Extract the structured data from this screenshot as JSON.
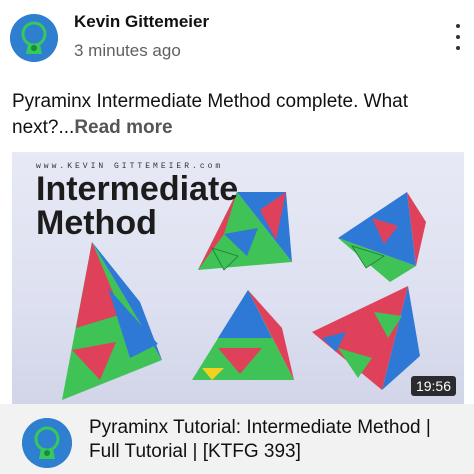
{
  "post": {
    "author": "Kevin Gittemeier",
    "time": "3 minutes ago",
    "text": "Pyraminx Intermediate Method complete. What next?",
    "ellipsis": "...",
    "read_more": "Read more"
  },
  "icons": {
    "avatar": "keychain-logo",
    "menu": "more-vert-icon"
  },
  "thumbnail": {
    "site": "www.KEVIN GITTEMEIER.com",
    "title_line1": "Intermediate",
    "title_line2": "Method",
    "duration": "19:56"
  },
  "video": {
    "title": "Pyraminx Tutorial: Intermediate Method | Full Tutorial | [KTFG 393]"
  },
  "colors": {
    "avatar_bg": "#2f7fd1",
    "red": "#e0415a",
    "green": "#3fc256",
    "blue": "#2e79d6",
    "yellow": "#f2d21f"
  }
}
